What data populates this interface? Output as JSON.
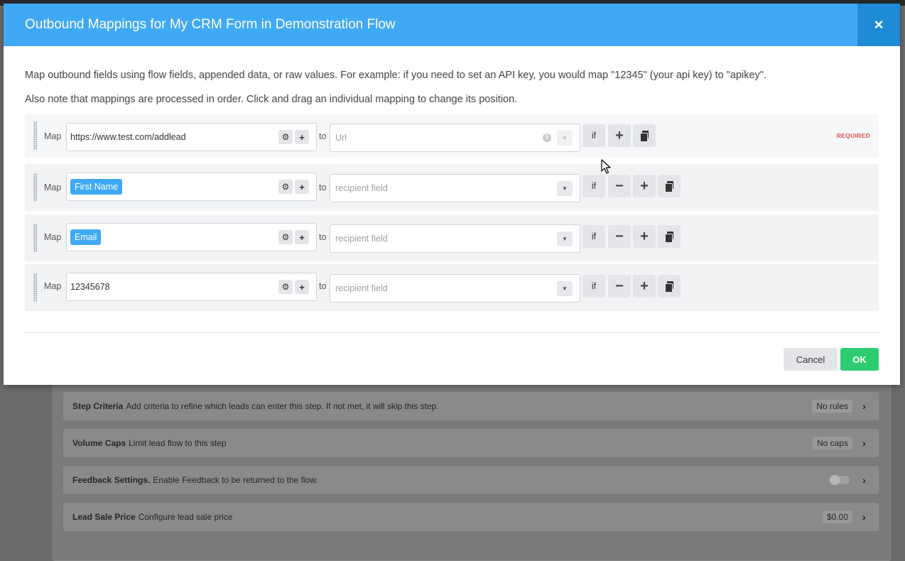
{
  "modal": {
    "title": "Outbound Mappings for My CRM Form in Demonstration Flow",
    "close_label": "×",
    "intro_line1": "Map outbound fields using flow fields, appended data, or raw values. For example: if you need to set an API key, you would map \"12345\" (your api key) to \"apikey\".",
    "intro_line2": "Also note that mappings are processed in order. Click and drag an individual mapping to change its position.",
    "map_label": "Map",
    "to_label": "to",
    "if_label": "if",
    "required_label": "REQUIRED",
    "mappings": [
      {
        "source_text": "https://www.test.com/addlead",
        "destination_placeholder": "Url"
      },
      {
        "source_chip": "First Name",
        "destination_placeholder": "recipient field"
      },
      {
        "source_chip": "Email",
        "destination_placeholder": "recipient field"
      },
      {
        "source_text": "12345678",
        "destination_placeholder": "recipient field"
      }
    ],
    "cancel_label": "Cancel",
    "ok_label": "OK"
  },
  "background": {
    "rows": [
      {
        "title": "Step Criteria",
        "desc": "Add criteria to refine which leads can enter this step. If not met, it will skip this step.",
        "value": "No rules"
      },
      {
        "title": "Volume Caps",
        "desc": "Limit lead flow to this step",
        "value": "No caps"
      },
      {
        "title": "Feedback Settings.",
        "desc": "Enable Feedback to be returned to the flow."
      },
      {
        "title": "Lead Sale Price",
        "desc": "Configure lead sale price",
        "value": "$0.00"
      }
    ]
  },
  "colors": {
    "header": "#3fa9f5",
    "close_button": "#1f8bd6",
    "chip": "#3fa9f5",
    "ok_button": "#2ecc71",
    "required_text": "#d9534f"
  }
}
